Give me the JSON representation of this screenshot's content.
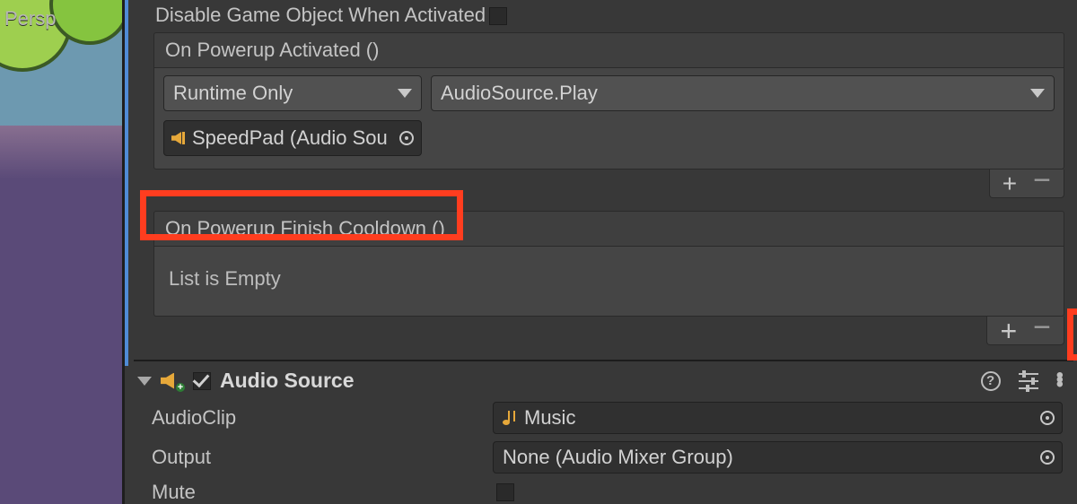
{
  "viewport": {
    "label": "Persp"
  },
  "component": {
    "disable_label": "Disable Game Object When Activated",
    "disable_checked": false,
    "events": {
      "activated": {
        "header": "On Powerup Activated ()",
        "runtime_mode": "Runtime Only",
        "function": "AudioSource.Play",
        "target_object": "SpeedPad (Audio Sou"
      },
      "cooldown": {
        "header": "On Powerup Finish Cooldown ()",
        "empty_text": "List is Empty"
      }
    }
  },
  "audio_source": {
    "title": "Audio Source",
    "enabled": true,
    "props": {
      "audioclip_label": "AudioClip",
      "audioclip_value": "Music",
      "output_label": "Output",
      "output_value": "None (Audio Mixer Group)",
      "mute_label": "Mute"
    }
  }
}
